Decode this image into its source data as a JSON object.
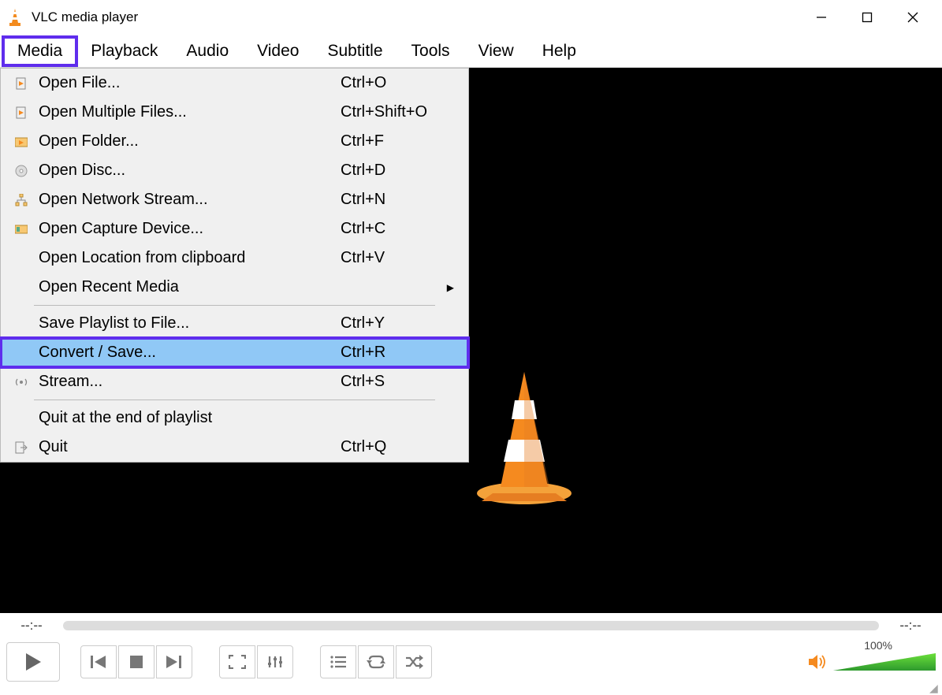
{
  "app": {
    "title": "VLC media player"
  },
  "menubar": [
    "Media",
    "Playback",
    "Audio",
    "Video",
    "Subtitle",
    "Tools",
    "View",
    "Help"
  ],
  "active_menu_index": 0,
  "dropdown": {
    "items": [
      {
        "icon": "file-play",
        "label": "Open File...",
        "shortcut": "Ctrl+O"
      },
      {
        "icon": "file-play",
        "label": "Open Multiple Files...",
        "shortcut": "Ctrl+Shift+O"
      },
      {
        "icon": "folder-play",
        "label": "Open Folder...",
        "shortcut": "Ctrl+F"
      },
      {
        "icon": "disc",
        "label": "Open Disc...",
        "shortcut": "Ctrl+D"
      },
      {
        "icon": "network",
        "label": "Open Network Stream...",
        "shortcut": "Ctrl+N"
      },
      {
        "icon": "capture",
        "label": "Open Capture Device...",
        "shortcut": "Ctrl+C"
      },
      {
        "icon": "",
        "label": "Open Location from clipboard",
        "shortcut": "Ctrl+V"
      },
      {
        "icon": "",
        "label": "Open Recent Media",
        "shortcut": "",
        "submenu": true
      },
      {
        "sep": true
      },
      {
        "icon": "",
        "label": "Save Playlist to File...",
        "shortcut": "Ctrl+Y"
      },
      {
        "icon": "",
        "label": "Convert / Save...",
        "shortcut": "Ctrl+R",
        "hi": true
      },
      {
        "icon": "stream",
        "label": "Stream...",
        "shortcut": "Ctrl+S"
      },
      {
        "sep": true
      },
      {
        "icon": "",
        "label": "Quit at the end of playlist",
        "shortcut": ""
      },
      {
        "icon": "quit",
        "label": "Quit",
        "shortcut": "Ctrl+Q"
      }
    ]
  },
  "seek": {
    "left": "--:--",
    "right": "--:--"
  },
  "volume": {
    "percent_label": "100%",
    "percent": 100
  }
}
